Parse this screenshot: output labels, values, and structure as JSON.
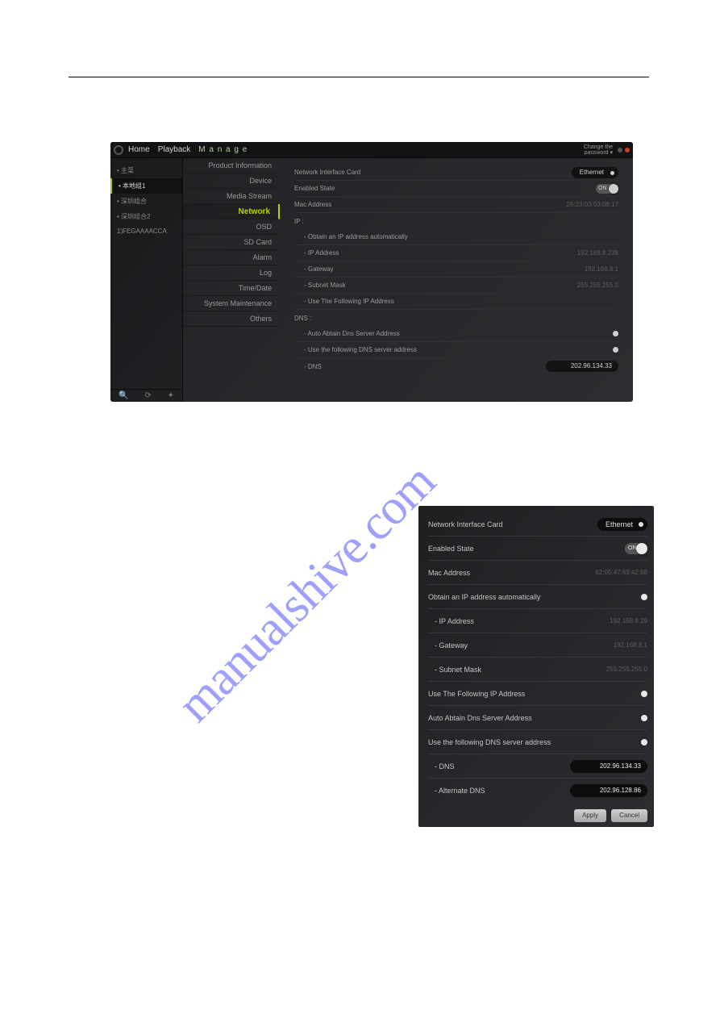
{
  "watermark": "manualshive.com",
  "app1": {
    "header": {
      "home": "Home",
      "playback": "Playback",
      "manage": "M a n a g e",
      "change": "Change the\npassword ▾"
    },
    "tree": {
      "items": [
        {
          "label": "• 主菜"
        },
        {
          "label": "• 本地组1"
        },
        {
          "label": "• 深圳组合"
        },
        {
          "label": "• 深圳组合2"
        },
        {
          "label": "1)FEGAAAACCA"
        }
      ],
      "active_index": 1
    },
    "nav": {
      "items": [
        "Product Information",
        "Device",
        "Media Stream",
        "Network",
        "OSD",
        "SD Card",
        "Alarm",
        "Log",
        "Time/Date",
        "System Maintenance",
        "Others"
      ],
      "active_index": 3
    },
    "main": {
      "nic_label": "Network Interface Card",
      "nic_value": "Ethernet",
      "enabled_label": "Enabled State",
      "enabled_value": "ON",
      "mac_label": "Mac Address",
      "mac_value": "26:23:03:03:08:17",
      "ip_header": "IP :",
      "auto_ip_label": "- Obtain an IP address automatically",
      "ip_label": "- IP Address",
      "ip_value": "192.168.8.238",
      "gw_label": "- Gateway",
      "gw_value": "192.168.8.1",
      "mask_label": "- Subnet Mask",
      "mask_value": "255.255.255.0",
      "use_ip_label": "- Use The Following IP Address",
      "dns_header": "DNS :",
      "auto_dns_label": "- Auto Abtain Dns Server Address",
      "use_dns_label": "- Use the following DNS server address",
      "dns_label": "- DNS",
      "dns_value": "202.96.134.33"
    }
  },
  "app2": {
    "nic_label": "Network Interface Card",
    "nic_value": "Ethernet",
    "enabled_label": "Enabled State",
    "enabled_value": "ON",
    "mac_label": "Mac Address",
    "mac_value": "62:05:47:69:42:88",
    "auto_ip_label": "Obtain an IP address automatically",
    "ip_label": "- IP Address",
    "ip_value": "192.168.8.29",
    "gw_label": "- Gateway",
    "gw_value": "192.168.8.1",
    "mask_label": "- Subnet Mask",
    "mask_value": "255.255.255.0",
    "use_ip_label": "Use The Following IP Address",
    "auto_dns_label": "Auto Abtain Dns Server Address",
    "use_dns_label": "Use the following DNS server address",
    "dns_label": "- DNS",
    "dns_value": "202.96.134.33",
    "alt_dns_label": "- Alternate DNS",
    "alt_dns_value": "202.96.128.86",
    "apply": "Apply",
    "cancel": "Cancel"
  }
}
